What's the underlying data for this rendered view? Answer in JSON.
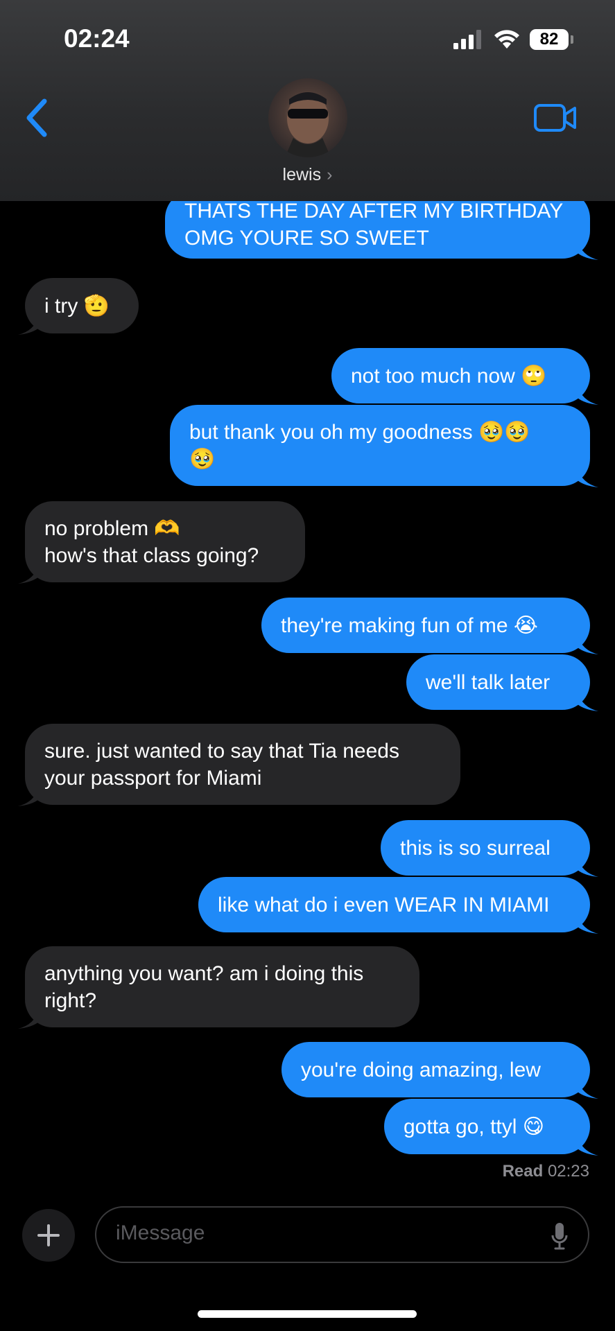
{
  "status": {
    "time": "02:24",
    "battery": "82"
  },
  "header": {
    "contact_name": "lewis",
    "chevron": "›"
  },
  "messages": [
    {
      "dir": "out",
      "text": "THATS THE DAY AFTER MY BIRTHDAY\nOMG YOURE SO SWEET"
    },
    {
      "dir": "in",
      "text": "i try 🫡"
    },
    {
      "dir": "out",
      "text": "not too much now 🙄"
    },
    {
      "dir": "out",
      "text": "but thank you oh my goodness 🥹🥹\n🥹"
    },
    {
      "dir": "in",
      "text": "no problem 🫶\nhow's that class going?"
    },
    {
      "dir": "out",
      "text": "they're making fun of me 😭"
    },
    {
      "dir": "out",
      "text": "we'll talk later"
    },
    {
      "dir": "in",
      "text": "sure. just wanted to say that Tia needs\nyour passport for Miami"
    },
    {
      "dir": "out",
      "text": "this is so surreal"
    },
    {
      "dir": "out",
      "text": "like what do i even WEAR IN MIAMI"
    },
    {
      "dir": "in",
      "text": "anything you want? am i doing this\nright?"
    },
    {
      "dir": "out",
      "text": "you're doing amazing, lew"
    },
    {
      "dir": "out",
      "text": "gotta go, ttyl 😋"
    }
  ],
  "read_receipt": {
    "label": "Read",
    "time": "02:23"
  },
  "composer": {
    "placeholder": "iMessage"
  },
  "icons": {
    "back": "chevron-left-icon",
    "video": "video-camera-icon",
    "plus": "plus-icon",
    "mic": "microphone-icon",
    "signal": "signal-bars-icon",
    "wifi": "wifi-icon",
    "battery": "battery-icon"
  },
  "colors": {
    "outgoing": "#1f8af8",
    "incoming": "#262628",
    "accent": "#1f8af8"
  }
}
